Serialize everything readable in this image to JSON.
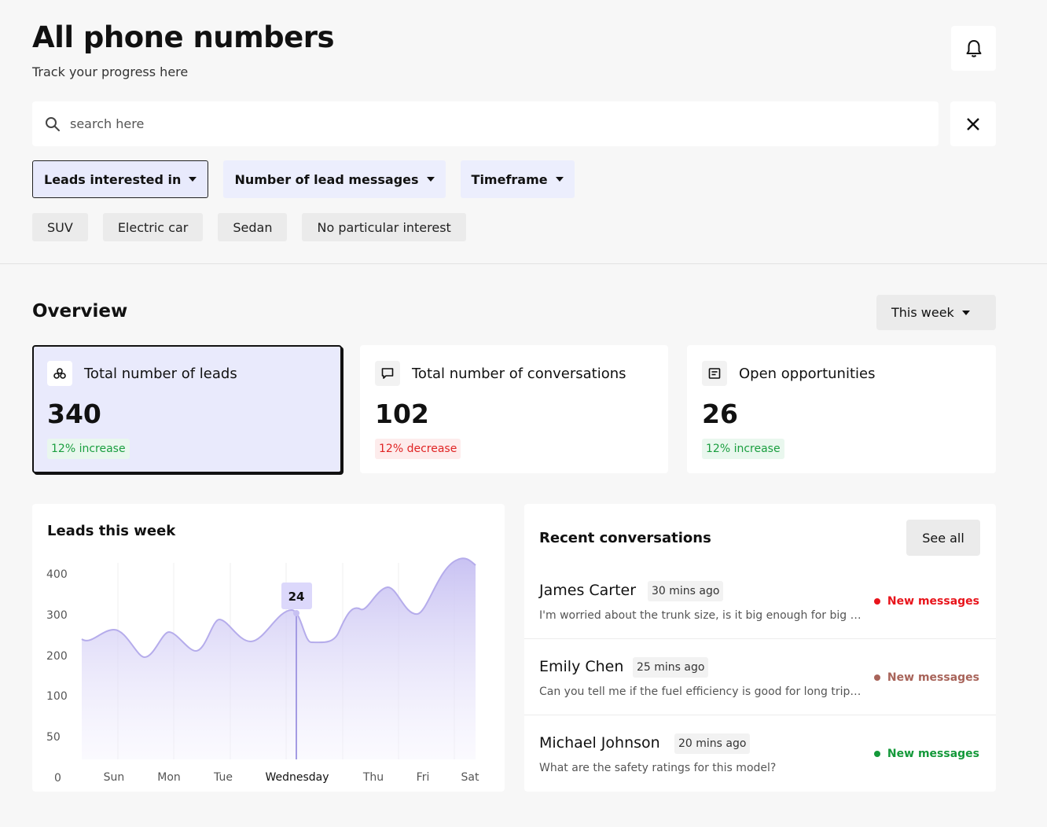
{
  "header": {
    "title": "All phone numbers",
    "subtitle": "Track your progress here"
  },
  "icons": {
    "bell": "bell-icon",
    "search": "search-icon",
    "close": "close-icon"
  },
  "search": {
    "placeholder": "search here"
  },
  "filters": [
    {
      "label": "Leads interested in",
      "active": true
    },
    {
      "label": "Number of lead messages",
      "active": false
    },
    {
      "label": "Timeframe",
      "active": false
    }
  ],
  "chips": [
    "SUV",
    "Electric car",
    "Sedan",
    "No particular interest"
  ],
  "overview": {
    "title": "Overview",
    "period": "This week",
    "cards": [
      {
        "label": "Total number of leads",
        "value": "340",
        "change": "12% increase",
        "trend": "up",
        "icon": "leads-icon"
      },
      {
        "label": "Total number of conversations",
        "value": "102",
        "change": "12% decrease",
        "trend": "down",
        "icon": "chat-icon"
      },
      {
        "label": "Open opportunities",
        "value": "26",
        "change": "12% increase",
        "trend": "up",
        "icon": "opportunities-icon"
      }
    ]
  },
  "chart_data": {
    "type": "area",
    "title": "Leads this week",
    "categories": [
      "Sun",
      "Mon",
      "Tue",
      "Wednesday",
      "Thu",
      "Fri",
      "Sat"
    ],
    "y_ticks": [
      "400",
      "300",
      "200",
      "100",
      "50",
      "0"
    ],
    "ylim": [
      0,
      400
    ],
    "highlight": {
      "category": "Wednesday",
      "label": "24"
    },
    "grid": true
  },
  "conversations": {
    "title": "Recent conversations",
    "see_all": "See all",
    "items": [
      {
        "name": "James Carter",
        "time": "30 mins ago",
        "preview": "I'm worried about the trunk size, is it big enough for big families?",
        "status": "New messages",
        "status_color": "#e8141b"
      },
      {
        "name": "Emily Chen",
        "time": "25 mins ago",
        "preview": "Can you tell me if the fuel efficiency is good for long trips?",
        "status": "New messages",
        "status_color": "#a8645a"
      },
      {
        "name": "Michael Johnson",
        "time": "20 mins ago",
        "preview": "What are the safety ratings for this model?",
        "status": "New messages",
        "status_color": "#14993a"
      }
    ]
  }
}
